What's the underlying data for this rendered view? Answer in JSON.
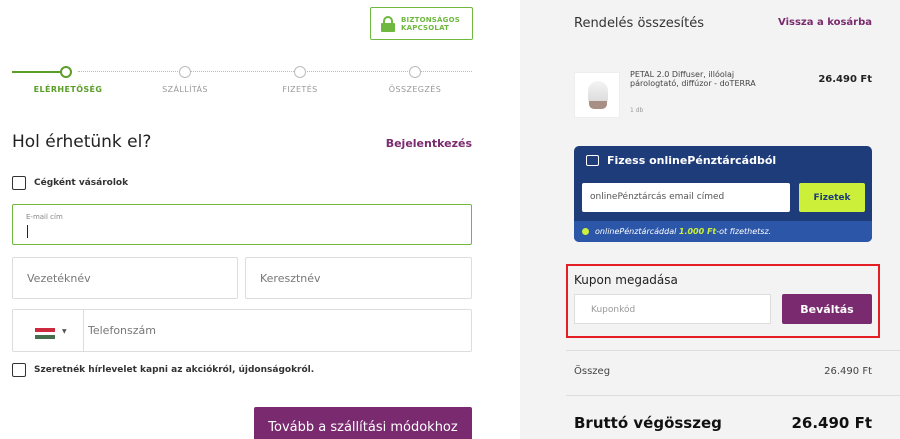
{
  "secure_badge": {
    "line1": "BIZTONSÁGOS",
    "line2": "KAPCSOLAT"
  },
  "steps": [
    {
      "label": "ELÉRHETŐSÉG",
      "active": true
    },
    {
      "label": "SZÁLLÍTÁS",
      "active": false
    },
    {
      "label": "FIZETÉS",
      "active": false
    },
    {
      "label": "ÖSSZEGZÉS",
      "active": false
    }
  ],
  "form": {
    "title": "Hol érhetünk el?",
    "login_link": "Bejelentkezés",
    "company_checkbox": "Cégként vásárolok",
    "email_label": "E-mail cím",
    "lastname_placeholder": "Vezetéknév",
    "firstname_placeholder": "Keresztnév",
    "phone_placeholder": "Telefonszám",
    "newsletter_checkbox": "Szeretnék hírlevelet kapni az akciókról, újdonságokról.",
    "continue_button": "Tovább a szállítási módokhoz"
  },
  "summary": {
    "title": "Rendelés összesítés",
    "back_link": "Vissza a kosárba",
    "product": {
      "name": "PETAL 2.0 Diffuser, illóolaj párologtató, diffúzor - doTERRA",
      "qty": "1 db",
      "price": "26.490 Ft"
    },
    "wallet": {
      "title": "Fizess onlinePénztárcádból",
      "email_placeholder": "onlinePénztárcás email címed",
      "pay_button": "Fizetek",
      "note_prefix": "onlinePénztárcáddal ",
      "note_amount": "1.000 Ft",
      "note_suffix": "-ot fizethetsz."
    },
    "coupon": {
      "title": "Kupon megadása",
      "placeholder": "Kuponkód",
      "button": "Beváltás"
    },
    "subtotal_label": "Összeg",
    "subtotal_value": "26.490 Ft",
    "gross_label": "Bruttó végösszeg",
    "gross_value": "26.490 Ft"
  },
  "colors": {
    "brand_purple": "#7a2a6e",
    "accent_green": "#6fb83f",
    "wallet_blue": "#1f3c7a",
    "wallet_lime": "#ccf03a",
    "highlight_red": "#e31e24"
  }
}
